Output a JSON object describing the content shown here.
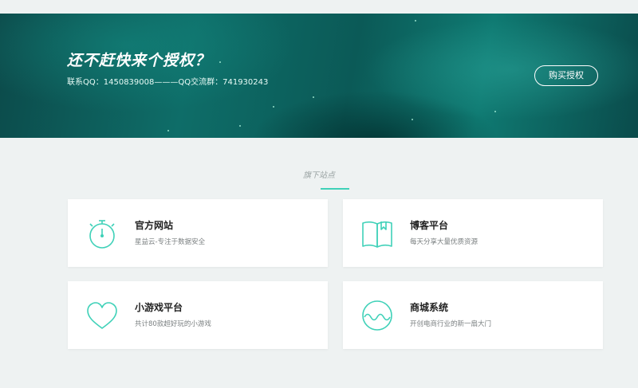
{
  "colors": {
    "accent": "#3fd1b8",
    "page_background": "#eef2f2",
    "banner_teal": "#0e6d68",
    "card_background": "#ffffff"
  },
  "banner": {
    "headline": "还不赶快来个授权？",
    "contact": "联系QQ：1450839008———QQ交流群：741930243",
    "buy_button_label": "购买授权"
  },
  "section": {
    "title": "旗下站点"
  },
  "cards": [
    {
      "icon": "stopwatch-icon",
      "title": "官方网站",
      "desc": "星益云-专注于数据安全"
    },
    {
      "icon": "book-icon",
      "title": "博客平台",
      "desc": "每天分享大量优质资源"
    },
    {
      "icon": "heart-icon",
      "title": "小游戏平台",
      "desc": "共计80款超好玩的小游戏"
    },
    {
      "icon": "wave-circle-icon",
      "title": "商城系统",
      "desc": "开创电商行业的新一扇大门"
    }
  ]
}
